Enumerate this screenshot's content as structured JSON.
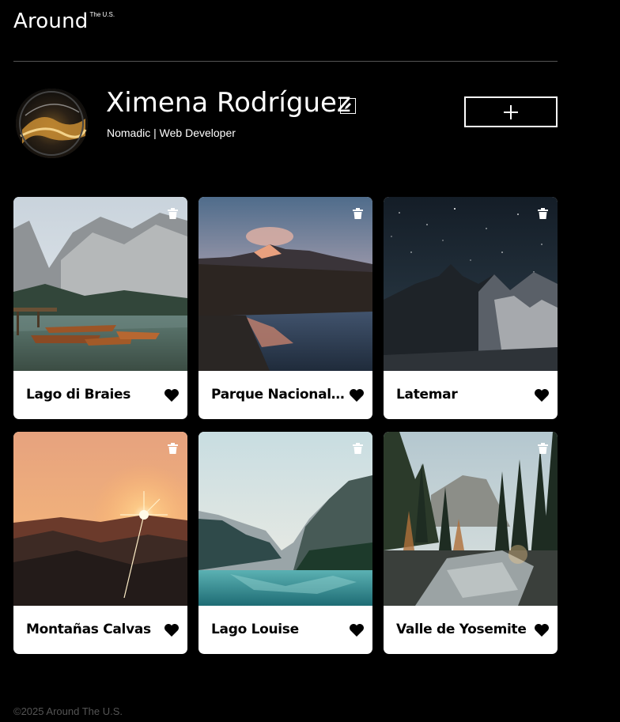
{
  "header": {
    "logo_main": "Around",
    "logo_sup": "The U.S."
  },
  "profile": {
    "name": "Ximena Rodríguez",
    "description": "Nomadic | Web Developer",
    "add_label": "+"
  },
  "cards": [
    {
      "title": "Lago di Braies",
      "scene": "lake-mountains-boats"
    },
    {
      "title": "Parque Nacional de la Vanoise",
      "scene": "alpine-lake-sunset"
    },
    {
      "title": "Latemar",
      "scene": "night-peaks-stars"
    },
    {
      "title": "Montañas Calvas",
      "scene": "sunset-mountains"
    },
    {
      "title": "Lago Louise",
      "scene": "turquoise-lake"
    },
    {
      "title": "Valle de Yosemite",
      "scene": "forest-river"
    }
  ],
  "footer": {
    "copyright": "©2025 Around The U.S."
  },
  "icons": {
    "edit": "pencil-icon",
    "add": "plus-icon",
    "delete": "trash-icon",
    "like": "heart-icon"
  },
  "colors": {
    "background": "#000000",
    "card": "#ffffff",
    "divider": "#545454",
    "text": "#ffffff"
  }
}
